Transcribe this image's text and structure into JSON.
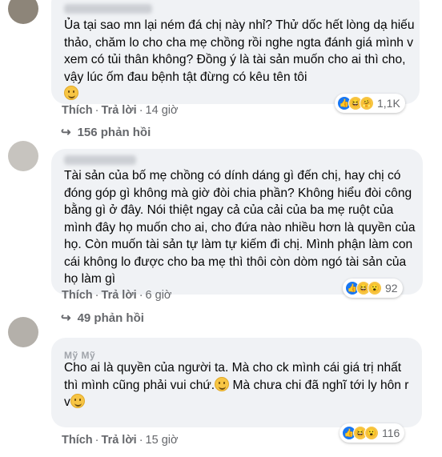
{
  "comments": [
    {
      "text": "Ủa tại sao mn lại ném đá chị này nhỉ? Thử dốc hết lòng dạ hiếu thảo, chăm lo cho cha mẹ chồng rồi nghe ngta đánh giá mình v xem có tủi thân không? Đồng ý là tài sản muốn cho ai thì cho, vậy lúc ốm đau bệnh tật đừng có kêu tên tôi",
      "like_label": "Thích",
      "reply_label": "Trả lời",
      "time": "14 giờ",
      "reaction_count": "1,1K",
      "replies": "156 phản hồi"
    },
    {
      "text": "Tài sản của bố mẹ chồng có dính dáng gì đến chị, hay chị có đóng góp gì không mà giờ đòi chia phần? Không hiểu đòi công bằng gì ở đây. Nói thiệt ngay cả của cải của ba mẹ ruột của mình đây họ muốn cho ai, cho đứa nào nhiều hơn là quyền của họ. Còn muốn tài sản tự làm tự kiếm đi chị. Mình phận làm con cái không lo được cho ba mẹ thì thôi còn dòm ngó tài sản của họ làm gì",
      "like_label": "Thích",
      "reply_label": "Trả lời",
      "time": "6 giờ",
      "reaction_count": "92",
      "replies": "49 phản hồi"
    },
    {
      "author": "Mỹ Mỹ",
      "text_a": "Cho ai là quyền của người ta. Mà cho ck mình cái giá trị nhất thì mình cũng phải vui chứ.",
      "text_b": " Mà chưa chi đã nghĩ tới ly hôn r v",
      "like_label": "Thích",
      "reply_label": "Trả lời",
      "time": "15 giờ",
      "reaction_count": "116"
    }
  ]
}
